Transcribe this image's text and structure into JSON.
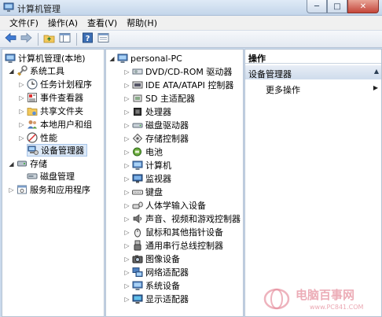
{
  "window": {
    "title": "计算机管理"
  },
  "window_controls": {
    "minimize": "─",
    "maximize": "□",
    "close": "✕"
  },
  "menu": [
    "文件(F)",
    "操作(A)",
    "查看(V)",
    "帮助(H)"
  ],
  "toolbar": [
    "back-icon",
    "forward-icon",
    "up-folder-icon",
    "show-hide-tree-icon",
    "help-icon",
    "properties-icon"
  ],
  "left_tree": {
    "root": "计算机管理(本地)",
    "groups": [
      {
        "label": "系统工具",
        "children": [
          "任务计划程序",
          "事件查看器",
          "共享文件夹",
          "本地用户和组",
          "性能",
          "设备管理器"
        ]
      },
      {
        "label": "存储",
        "children": [
          "磁盘管理"
        ]
      },
      {
        "label": "服务和应用程序",
        "children": []
      }
    ],
    "selected": "设备管理器"
  },
  "device_tree": {
    "root": "personal-PC",
    "items": [
      {
        "label": "DVD/CD-ROM 驱动器",
        "icon": "dvd-drive-icon"
      },
      {
        "label": "IDE ATA/ATAPI 控制器",
        "icon": "ide-controller-icon"
      },
      {
        "label": "SD 主适配器",
        "icon": "sd-adapter-icon"
      },
      {
        "label": "处理器",
        "icon": "processor-icon"
      },
      {
        "label": "磁盘驱动器",
        "icon": "disk-drive-icon"
      },
      {
        "label": "存储控制器",
        "icon": "storage-controller-icon"
      },
      {
        "label": "电池",
        "icon": "battery-icon"
      },
      {
        "label": "计算机",
        "icon": "computer-icon"
      },
      {
        "label": "监视器",
        "icon": "monitor-icon"
      },
      {
        "label": "键盘",
        "icon": "keyboard-icon"
      },
      {
        "label": "人体学输入设备",
        "icon": "hid-icon"
      },
      {
        "label": "声音、视频和游戏控制器",
        "icon": "sound-icon"
      },
      {
        "label": "鼠标和其他指针设备",
        "icon": "mouse-icon"
      },
      {
        "label": "通用串行总线控制器",
        "icon": "usb-icon"
      },
      {
        "label": "图像设备",
        "icon": "imaging-device-icon"
      },
      {
        "label": "网络适配器",
        "icon": "network-adapter-icon"
      },
      {
        "label": "系统设备",
        "icon": "system-device-icon"
      },
      {
        "label": "显示适配器",
        "icon": "display-adapter-icon"
      }
    ]
  },
  "actions": {
    "header": "操作",
    "section": "设备管理器",
    "more": "更多操作"
  },
  "watermark": {
    "brand": "电脑百事网",
    "url": "www.PC841.COM"
  }
}
